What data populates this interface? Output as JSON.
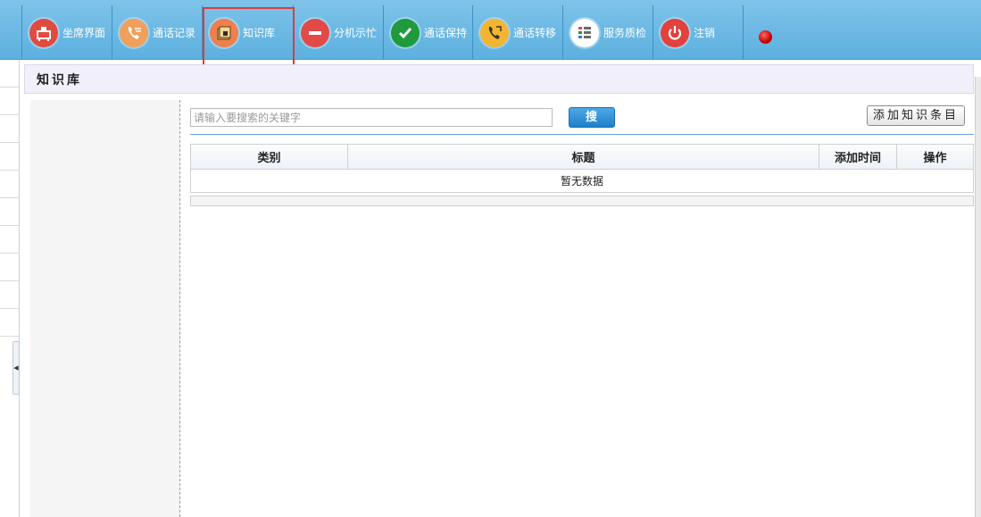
{
  "toolbar": {
    "items": [
      {
        "label": "坐席界面",
        "icon": "agent-desk-icon",
        "color": "#e04b3f"
      },
      {
        "label": "通话记录",
        "icon": "phone-call-record-icon",
        "color": "#f0a05a"
      },
      {
        "label": "知识库",
        "icon": "knowledge-base-icon",
        "color": "#ef7f4e"
      },
      {
        "label": "分机示忙",
        "icon": "busy-icon",
        "color": "#e24a48"
      },
      {
        "label": "通话保持",
        "icon": "call-hold-icon",
        "color": "#1f9a3c"
      },
      {
        "label": "通话转移",
        "icon": "call-transfer-icon",
        "color": "#f3b431"
      },
      {
        "label": "服务质检",
        "icon": "quality-check-icon",
        "color": "#ffffff"
      },
      {
        "label": "注销",
        "icon": "power-icon",
        "color": "#e2413d"
      }
    ],
    "status_color": "#c40000"
  },
  "panel": {
    "title": "知识库"
  },
  "search": {
    "placeholder": "请输入要搜索的关键字",
    "value": "",
    "button_label": "搜 索"
  },
  "actions": {
    "add_label": "添加知识条目"
  },
  "grid": {
    "columns": [
      "类别",
      "标题",
      "添加时间",
      "操作"
    ],
    "empty_text": "暂无数据"
  }
}
